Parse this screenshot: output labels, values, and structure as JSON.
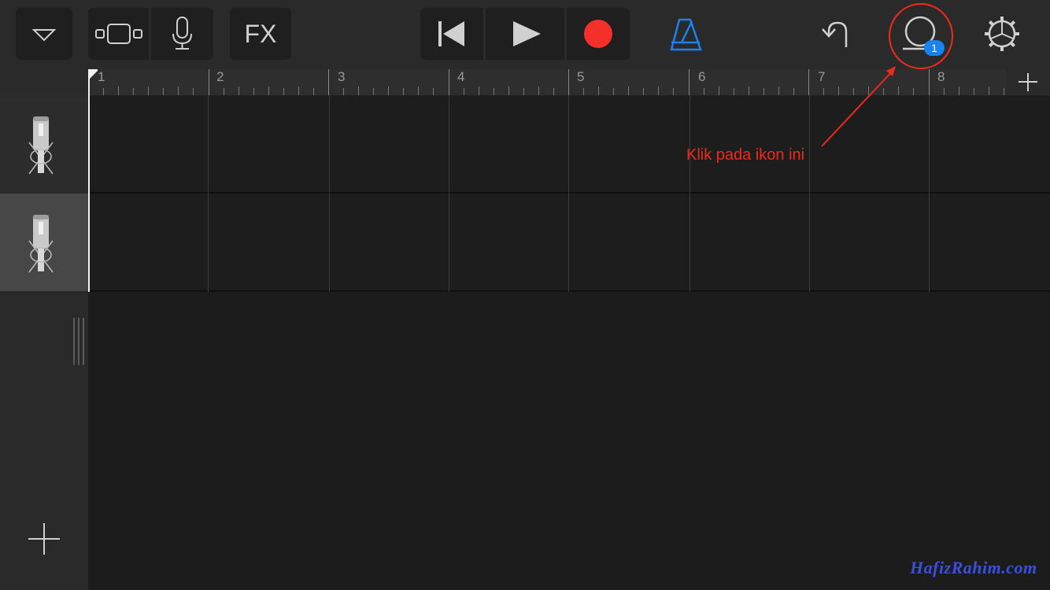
{
  "toolbar": {
    "browser_icon": "triangle-down-icon",
    "view_toggle_icon": "track-view-icon",
    "mic_icon": "microphone-icon",
    "fx_label": "FX",
    "rewind_icon": "skip-back-icon",
    "play_icon": "play-icon",
    "record_icon": "record-icon",
    "metronome_icon": "metronome-icon",
    "undo_icon": "undo-icon",
    "loop_icon": "loop-browser-icon",
    "loop_badge": "1",
    "settings_icon": "gear-icon",
    "colors": {
      "record": "#f5302a",
      "metronome": "#1a82f0",
      "badge": "#1a82f0"
    }
  },
  "ruler": {
    "bars": [
      "1",
      "2",
      "3",
      "4",
      "5",
      "6",
      "7",
      "8"
    ],
    "add_icon": "plus-icon"
  },
  "tracks": [
    {
      "instrument_icon": "condenser-mic-icon",
      "selected": false
    },
    {
      "instrument_icon": "condenser-mic-icon",
      "selected": true
    }
  ],
  "add_track_icon": "plus-icon",
  "annotation": {
    "text": "Klik pada ikon ini",
    "color": "#f02a1a"
  },
  "watermark": "HafizRahim.com"
}
